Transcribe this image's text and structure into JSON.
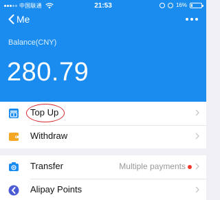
{
  "status_bar": {
    "carrier": "中国联通",
    "time": "21:53",
    "battery": "16%",
    "battery_level": 0.16
  },
  "nav": {
    "back_label": "Me"
  },
  "balance": {
    "label": "Balance(CNY)",
    "value": "280.79"
  },
  "menu_group_1": [
    {
      "label": "Top Up",
      "icon": "top-up-icon"
    },
    {
      "label": "Withdraw",
      "icon": "wallet-icon"
    }
  ],
  "menu_group_2": [
    {
      "label": "Transfer",
      "icon": "transfer-icon",
      "value": "Multiple payments"
    },
    {
      "label": "Alipay Points",
      "icon": "points-icon"
    }
  ],
  "colors": {
    "header": "#1a8cf0",
    "highlight": "#d7262d",
    "badge": "#f0392b",
    "withdraw_icon": "#f5a623",
    "points_icon": "#4a5bd4"
  }
}
